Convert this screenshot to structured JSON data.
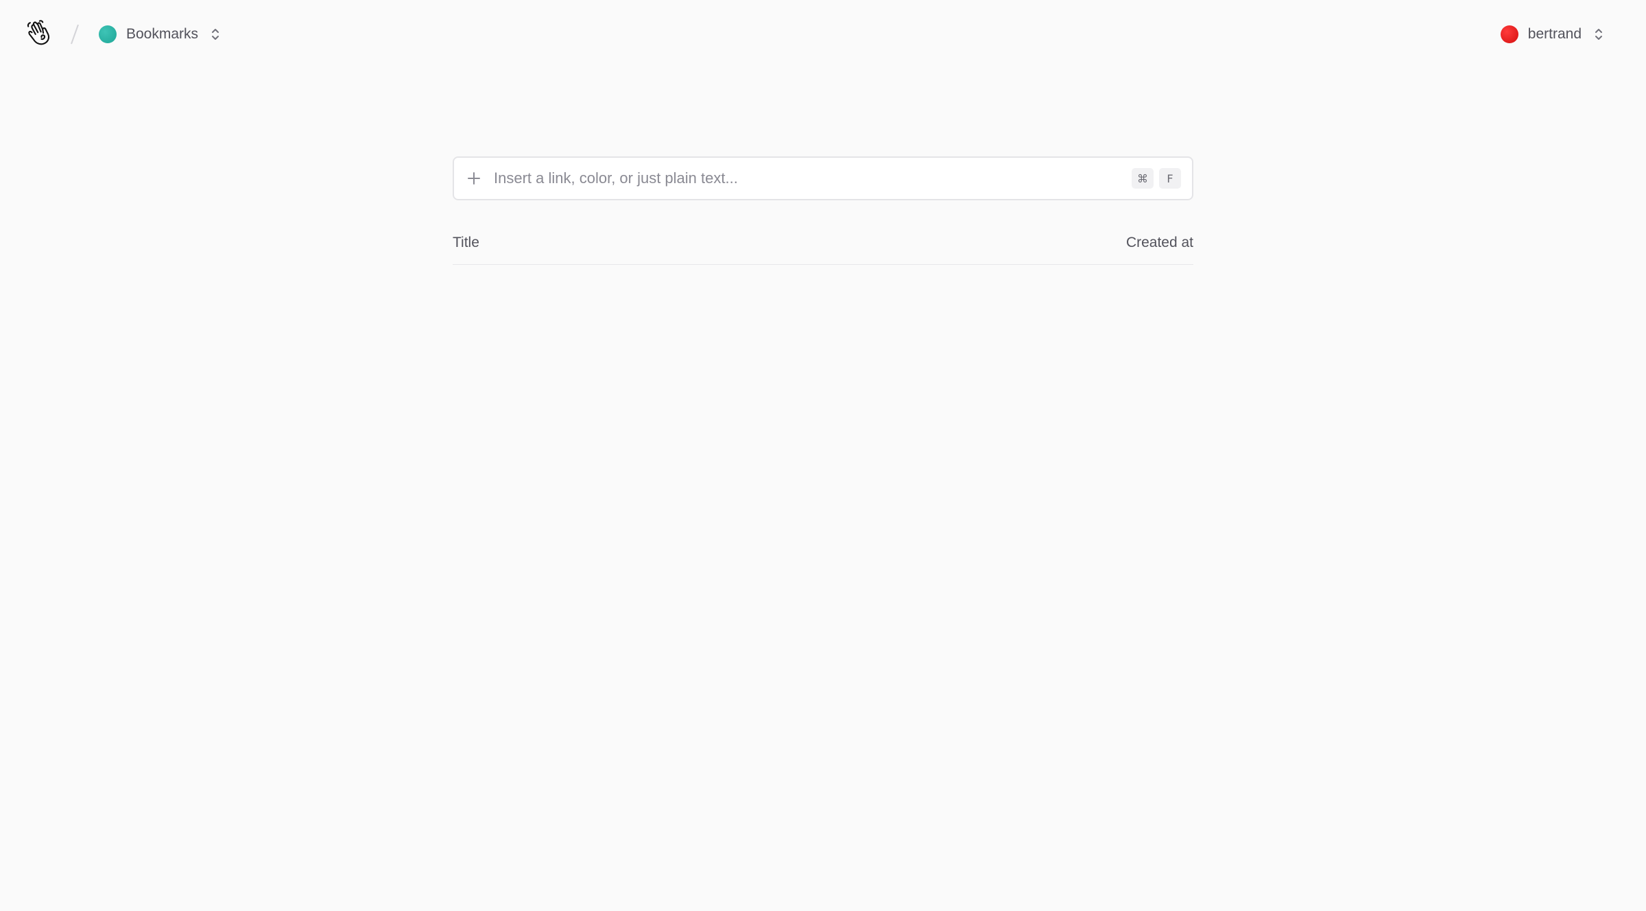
{
  "header": {
    "logo_icon": "hand-wave-icon",
    "collection": {
      "name": "Bookmarks",
      "color": "#2bb5a6"
    },
    "user": {
      "name": "bertrand",
      "color": "#e31010"
    }
  },
  "search": {
    "placeholder": "Insert a link, color, or just plain text...",
    "value": "",
    "shortcut": [
      "⌘",
      "F"
    ]
  },
  "table": {
    "columns": [
      "Title",
      "Created at"
    ],
    "rows": []
  }
}
